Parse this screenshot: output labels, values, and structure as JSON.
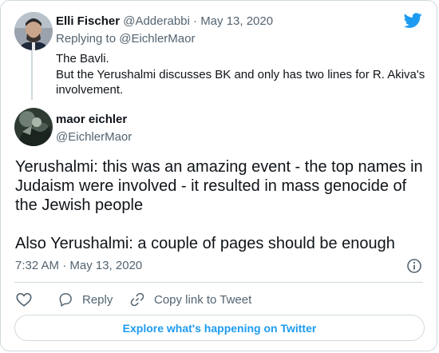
{
  "reply_tweet": {
    "author_name": "Elli Fischer",
    "author_handle": "@Adderabbi",
    "separator": "·",
    "date": "May 13, 2020",
    "replying_to": "Replying to @EichlerMaor",
    "text_lines": [
      "The Bavli.",
      "But the Yerushalmi discusses BK and only has two lines for R. Akiva's",
      "involvement."
    ]
  },
  "main_tweet": {
    "author_name": "maor eichler",
    "author_handle": "@EichlerMaor",
    "text_lines": [
      "Yerushalmi: this was an amazing event - the top names in",
      "Judaism were involved - it resulted in mass genocide of",
      "the Jewish people",
      "",
      "Also Yerushalmi: a couple of pages should be enough"
    ],
    "timestamp": "7:32 AM · May 13, 2020"
  },
  "actions": {
    "reply_label": "Reply",
    "copy_link_label": "Copy link to Tweet"
  },
  "footer": {
    "explore_label": "Explore what's happening on Twitter"
  },
  "colors": {
    "brand": "#1d9bf0",
    "text": "#0f1419",
    "secondary": "#536471",
    "border": "#cfd9de"
  },
  "icons": [
    "twitter-bird-icon",
    "info-icon",
    "heart-icon",
    "reply-icon",
    "link-icon"
  ]
}
